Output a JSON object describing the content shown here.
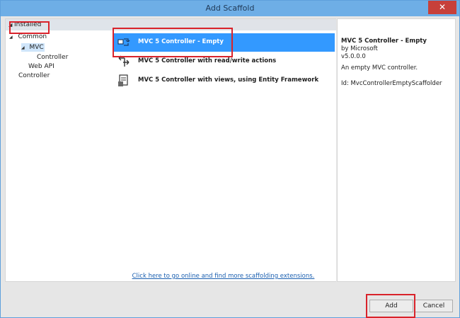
{
  "window": {
    "title": "Add Scaffold",
    "close_label": "✕"
  },
  "tree": {
    "installed_label": "Installed",
    "common_label": "Common",
    "mvc_label": "MVC",
    "controller_child_label": "Controller",
    "webapi_label": "Web API",
    "controller_label": "Controller"
  },
  "scaffolds": [
    {
      "label": "MVC 5 Controller - Empty",
      "selected": true,
      "icon": "controller-empty-icon"
    },
    {
      "label": "MVC 5 Controller with read/write actions",
      "selected": false,
      "icon": "controller-readwrite-icon"
    },
    {
      "label": "MVC 5 Controller with views, using Entity Framework",
      "selected": false,
      "icon": "controller-views-icon"
    }
  ],
  "online_link": "Click here to go online and find more scaffolding extensions.",
  "details": {
    "title": "MVC 5 Controller - Empty",
    "author": "by Microsoft",
    "version": "v5.0.0.0",
    "description": "An empty MVC controller.",
    "id": "Id: MvcControllerEmptyScaffolder"
  },
  "buttons": {
    "add": "Add",
    "cancel": "Cancel"
  },
  "colors": {
    "accent": "#3399ff",
    "titlebar": "#6eaee6",
    "highlight": "#d9232b",
    "close": "#c7403a"
  }
}
